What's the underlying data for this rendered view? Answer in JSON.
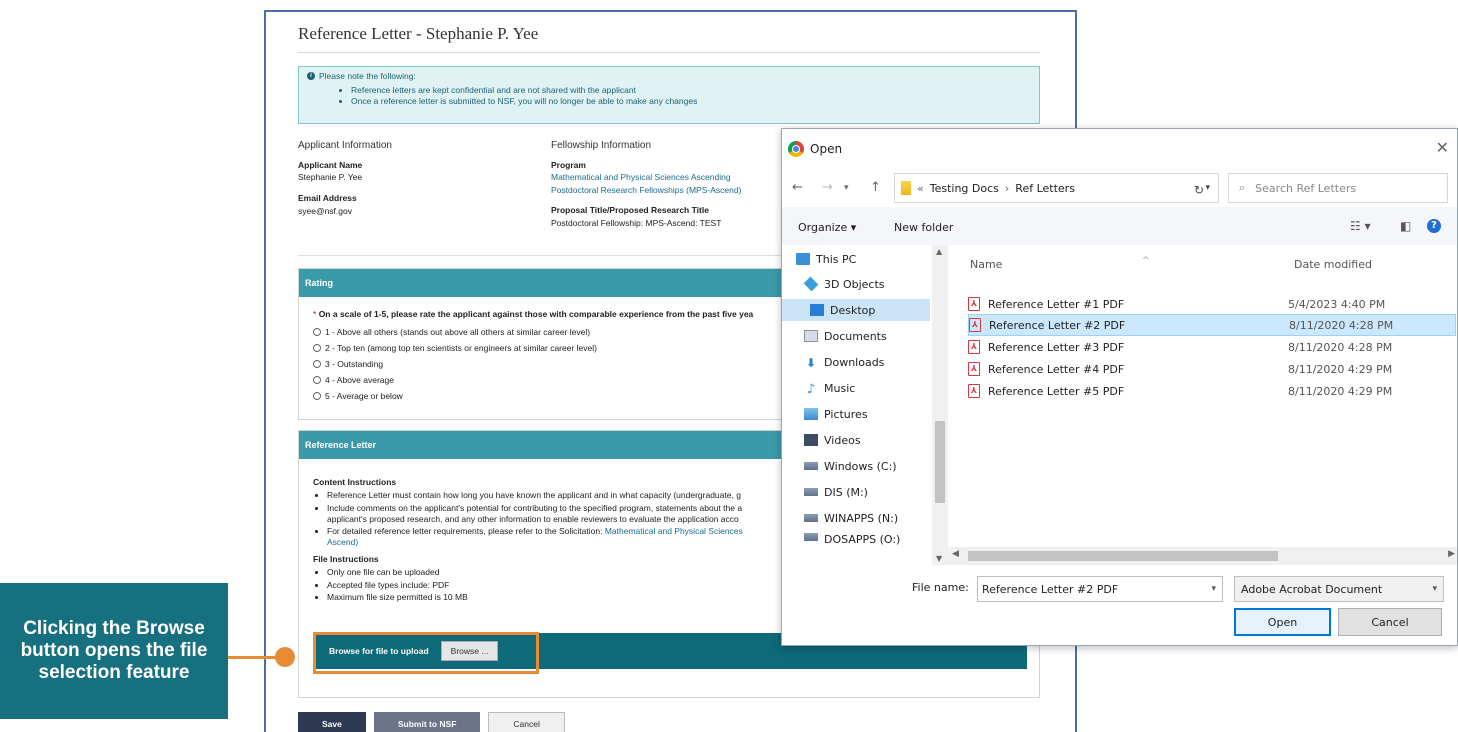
{
  "page": {
    "title": "Reference Letter - Stephanie P. Yee",
    "notice": {
      "heading": "Please note the following:",
      "items": [
        "Reference letters are kept confidential and are not shared with the applicant",
        "Once a reference letter is submitted to NSF, you will no longer be able to make any changes"
      ]
    },
    "applicant": {
      "section": "Applicant Information",
      "name_label": "Applicant Name",
      "name": "Stephanie P. Yee",
      "email_label": "Email Address",
      "email": "syee@nsf.gov"
    },
    "fellowship": {
      "section": "Fellowship Information",
      "program_label": "Program",
      "program_line1": "Mathematical and Physical Sciences Ascending",
      "program_line2": "Postdoctoral Research Fellowships (MPS-Ascend)",
      "proposal_label": "Proposal Title/Proposed Research Title",
      "proposal": "Postdoctoral Fellowship: MPS-Ascend: TEST"
    },
    "rating": {
      "header": "Rating",
      "required_mark": "*",
      "question": "On a scale of 1-5, please rate the applicant against those with comparable experience from the past five yea",
      "options": [
        "1 - Above all others (stands out above all others at similar career level)",
        "2 - Top ten (among top ten scientists or engineers at similar career level)",
        "3 - Outstanding",
        "4 - Above average",
        "5 - Average or below"
      ]
    },
    "reference_letter": {
      "header": "Reference Letter",
      "content_heading": "Content Instructions",
      "content_items": [
        "Reference Letter must contain how long you have known the applicant and in what capacity (undergraduate, g",
        "Include comments on the applicant's potential for contributing to the specified program, statements about the a",
        "applicant's proposed research, and any other information to enable reviewers to evaluate the application acco",
        "For detailed reference letter requirements, please refer to the Solicitation:",
        "Ascend)"
      ],
      "solicitation_link": "Mathematical and Physical Sciences",
      "file_heading": "File Instructions",
      "file_items": [
        "Only one file can be uploaded",
        "Accepted file types include: PDF",
        "Maximum file size permitted is 10 MB"
      ],
      "upload_label": "Browse for file to upload",
      "browse_label": "Browse ..."
    },
    "buttons": {
      "save": "Save",
      "submit": "Submit to NSF",
      "cancel": "Cancel"
    }
  },
  "callout": {
    "text": "Clicking the Browse button opens the file selection feature",
    "color": "#16707f",
    "accent": "#e58c35"
  },
  "dialog": {
    "title": "Open",
    "breadcrumb": [
      "Testing Docs",
      "Ref Letters"
    ],
    "search_placeholder": "Search Ref Letters",
    "organize": "Organize",
    "new_folder": "New folder",
    "nav_items": [
      {
        "label": "This PC",
        "icon": "pc-icon"
      },
      {
        "label": "3D Objects",
        "icon": "3d-objects-icon"
      },
      {
        "label": "Desktop",
        "icon": "desktop-icon",
        "selected": true
      },
      {
        "label": "Documents",
        "icon": "documents-icon"
      },
      {
        "label": "Downloads",
        "icon": "downloads-icon"
      },
      {
        "label": "Music",
        "icon": "music-icon"
      },
      {
        "label": "Pictures",
        "icon": "pictures-icon"
      },
      {
        "label": "Videos",
        "icon": "videos-icon"
      },
      {
        "label": "Windows (C:)",
        "icon": "drive-icon"
      },
      {
        "label": "DIS (M:)",
        "icon": "network-drive-icon"
      },
      {
        "label": "WINAPPS (N:)",
        "icon": "network-drive-icon"
      },
      {
        "label": "DOSAPPS (O:)",
        "icon": "network-drive-icon"
      }
    ],
    "columns": {
      "name": "Name",
      "date": "Date modified"
    },
    "files": [
      {
        "name": "Reference Letter #1 PDF",
        "date": "5/4/2023 4:40 PM"
      },
      {
        "name": "Reference Letter #2 PDF",
        "date": "8/11/2020 4:28 PM",
        "selected": true
      },
      {
        "name": "Reference Letter #3 PDF",
        "date": "8/11/2020 4:28 PM"
      },
      {
        "name": "Reference Letter #4 PDF",
        "date": "8/11/2020 4:29 PM"
      },
      {
        "name": "Reference Letter #5 PDF",
        "date": "8/11/2020 4:29 PM"
      }
    ],
    "file_name_label": "File name:",
    "file_name_value": "Reference Letter #2 PDF",
    "file_type": "Adobe Acrobat Document",
    "open_label": "Open",
    "cancel_label": "Cancel"
  }
}
